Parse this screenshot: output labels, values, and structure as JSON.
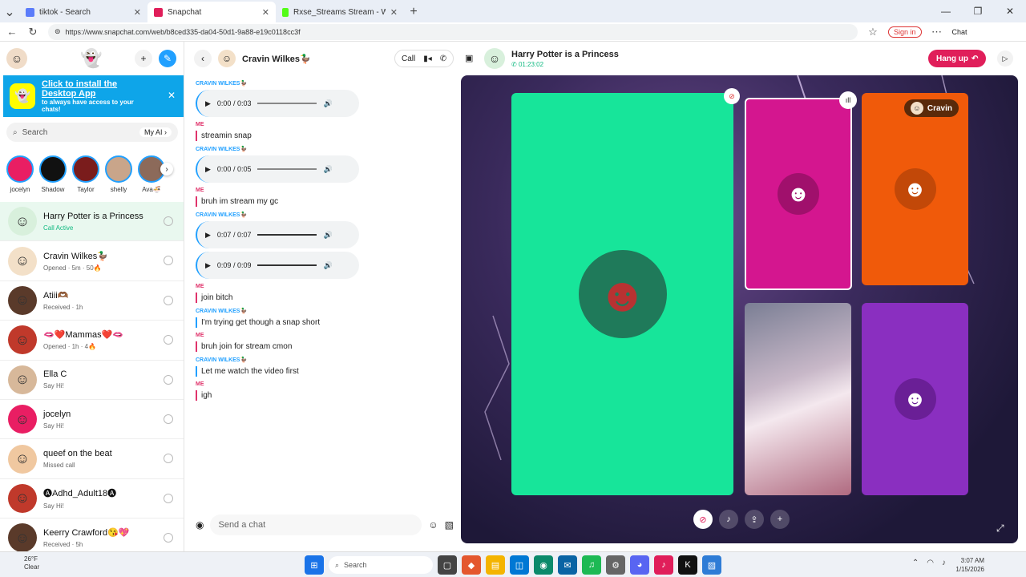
{
  "browser": {
    "tabs": [
      {
        "title": "tiktok - Search",
        "color": "#5b7cfa"
      },
      {
        "title": "Snapchat",
        "color": "#e01e5a"
      },
      {
        "title": "Rxse_Streams Stream - Watch Live",
        "color": "#53fc18"
      }
    ],
    "url": "https://www.snapchat.com/web/b8ced335-da04-50d1-9a88-e19c0118cc3f",
    "signin_label": "Sign in",
    "chat_label": "Chat"
  },
  "sidebar": {
    "banner_title": "Click to install the Desktop App",
    "banner_sub": "to always have access to your chats!",
    "search_placeholder": "Search",
    "myai_label": "My AI",
    "stories": [
      {
        "name": "jocelyn",
        "bg": "#e91e63"
      },
      {
        "name": "Shadow",
        "bg": "#111111"
      },
      {
        "name": "Taylor",
        "bg": "#7a1c1c"
      },
      {
        "name": "shelly",
        "bg": "#c9a58a"
      },
      {
        "name": "Ava🍜",
        "bg": "#8c6a5a"
      }
    ],
    "chats": [
      {
        "name": "Harry Potter is a Princess",
        "status": "Call Active",
        "bg": "#d8f0dc"
      },
      {
        "name": "Cravin Wilkes🦆",
        "status": "Opened · 5m · 50🔥",
        "bg": "#f3e0c8"
      },
      {
        "name": "Atiii🫶🏾",
        "status": "Received · 1h",
        "bg": "#5a3a2a"
      },
      {
        "name": "🫦❤️Mammas❤️🫦",
        "status": "Opened · 1h · 4🔥",
        "bg": "#c0392b"
      },
      {
        "name": "Ella C",
        "status": "Say Hi!",
        "bg": "#d7b89a"
      },
      {
        "name": "jocelyn",
        "status": "Say Hi!",
        "bg": "#e91e63"
      },
      {
        "name": "queef on the beat",
        "status": "Missed call",
        "bg": "#f0c8a0"
      },
      {
        "name": "🅐Adhd_Adult18🅐",
        "status": "Say Hi!",
        "bg": "#c0392b"
      },
      {
        "name": "Keerry Crawford😘💖",
        "status": "Received · 5h",
        "bg": "#5a3a2a"
      }
    ]
  },
  "conversation": {
    "contact_name": "Cravin Wilkes🦆",
    "call_label": "Call",
    "composer_placeholder": "Send a chat",
    "messages": [
      {
        "sender": "CRAVIN WILKES🦆",
        "who": "c",
        "type": "audio",
        "time": "0:00 / 0:03",
        "full": false
      },
      {
        "sender": "ME",
        "who": "m",
        "type": "text",
        "text": "streamin snap"
      },
      {
        "sender": "CRAVIN WILKES🦆",
        "who": "c",
        "type": "audio",
        "time": "0:00 / 0:05",
        "full": false
      },
      {
        "sender": "ME",
        "who": "m",
        "type": "text",
        "text": "bruh im stream my gc"
      },
      {
        "sender": "CRAVIN WILKES🦆",
        "who": "c",
        "type": "audio",
        "time": "0:07 / 0:07",
        "full": true
      },
      {
        "sender": "",
        "who": "c",
        "type": "audio",
        "time": "0:09 / 0:09",
        "full": true
      },
      {
        "sender": "ME",
        "who": "m",
        "type": "text",
        "text": "join bitch"
      },
      {
        "sender": "CRAVIN WILKES🦆",
        "who": "c",
        "type": "text",
        "text": "I'm trying get though a snap short"
      },
      {
        "sender": "ME",
        "who": "m",
        "type": "text",
        "text": "bruh join for stream cmon"
      },
      {
        "sender": "CRAVIN WILKES🦆",
        "who": "c",
        "type": "text",
        "text": "Let me watch the video first"
      },
      {
        "sender": "ME",
        "who": "m",
        "type": "text",
        "text": "igh"
      }
    ]
  },
  "call": {
    "group_name": "Harry Potter is a Princess",
    "duration": "01:23:02",
    "hangup_label": "Hang up",
    "tile_name": "Cravin",
    "colors": {
      "green": "#17e59a",
      "pink": "#d4168f",
      "orange": "#f05a0a",
      "purple": "#8a2fc0"
    }
  },
  "taskbar": {
    "temp": "26°F",
    "weather": "Clear",
    "search_placeholder": "Search",
    "time": "3:07 AM",
    "date": "1/15/2026"
  }
}
